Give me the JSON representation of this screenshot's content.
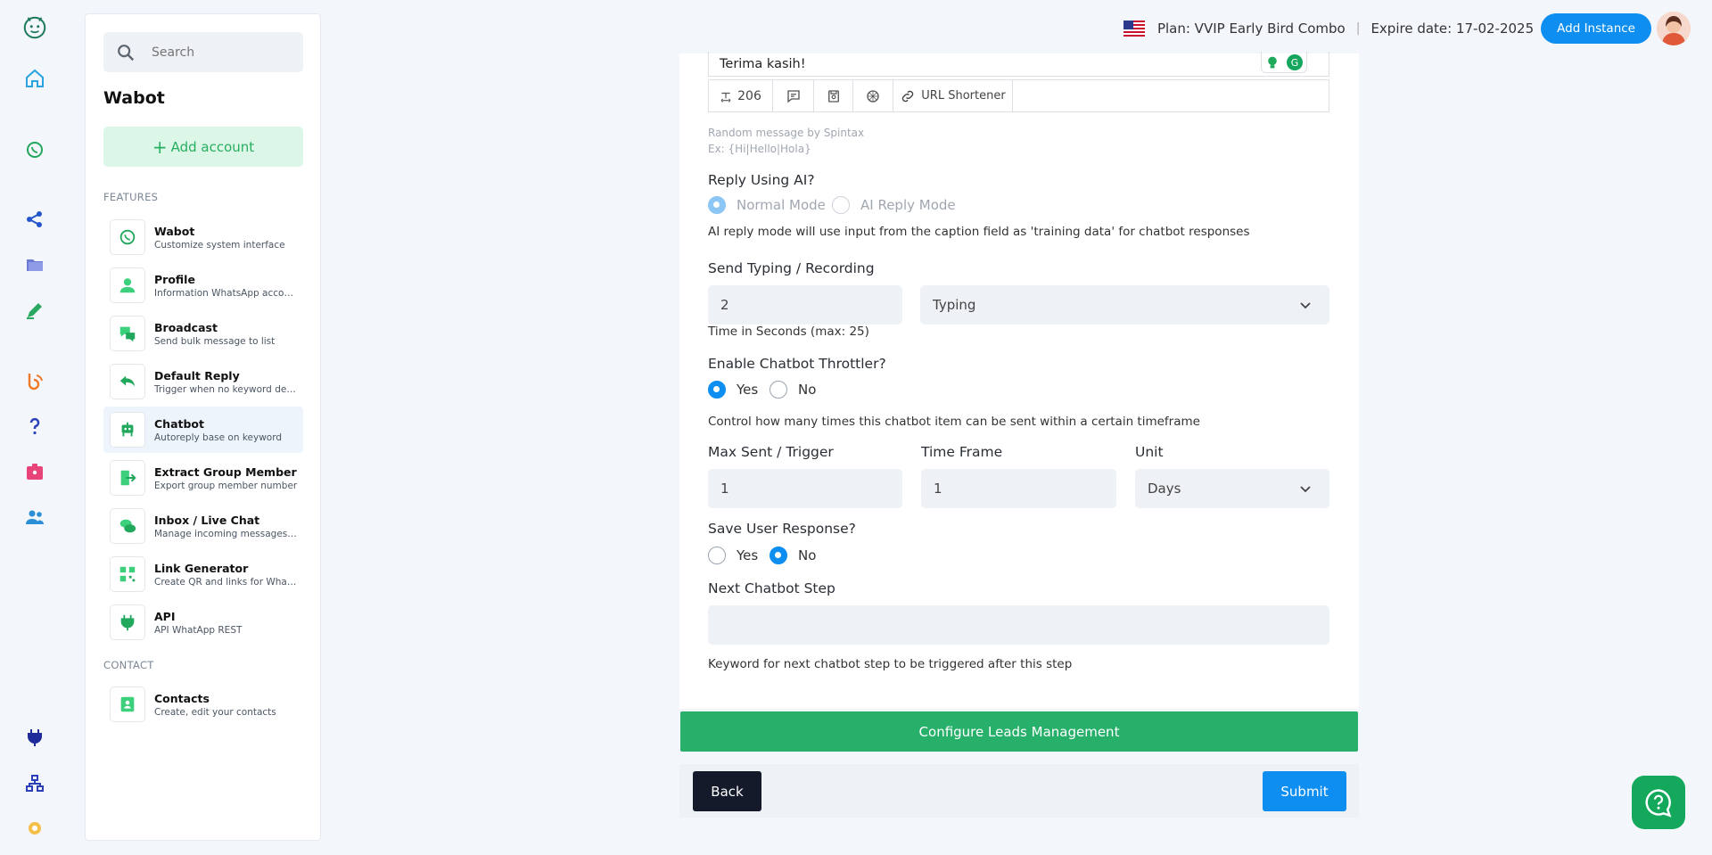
{
  "header": {
    "plan": "Plan: VVIP Early Bird Combo",
    "separator": "|",
    "expire": "Expire date: 17-02-2025",
    "add_instance": "Add Instance"
  },
  "sidebar": {
    "search_placeholder": "Search",
    "title": "Wabot",
    "add_account": "Add account",
    "features_label": "FEATURES",
    "contact_label": "CONTACT",
    "items": [
      {
        "name": "Wabot",
        "desc": "Customize system interface"
      },
      {
        "name": "Profile",
        "desc": "Information WhatsApp account"
      },
      {
        "name": "Broadcast",
        "desc": "Send bulk message to list"
      },
      {
        "name": "Default Reply",
        "desc": "Trigger when no keyword detected"
      },
      {
        "name": "Chatbot",
        "desc": "Autoreply base on keyword"
      },
      {
        "name": "Extract Group Member",
        "desc": "Export group member number"
      },
      {
        "name": "Inbox / Live Chat",
        "desc": "Manage incoming messages and chats"
      },
      {
        "name": "Link Generator",
        "desc": "Create QR and links for WhatsApp"
      },
      {
        "name": "API",
        "desc": "API WhatApp REST"
      }
    ],
    "contacts": {
      "name": "Contacts",
      "desc": "Create, edit your contacts"
    }
  },
  "form": {
    "message_text": "Terima kasih!",
    "char_count": "206",
    "url_shortener": "URL Shortener",
    "spintax_hint": "Random message by Spintax",
    "spintax_example": "Ex: {Hi|Hello|Hola}",
    "reply_ai_label": "Reply Using AI?",
    "normal_mode": "Normal Mode",
    "ai_mode": "AI Reply Mode",
    "ai_note": "AI reply mode will use input from the caption field as 'training data' for chatbot responses",
    "typing_label": "Send Typing / Recording",
    "typing_seconds": "2",
    "typing_type": "Typing",
    "typing_note": "Time in Seconds (max: 25)",
    "throttler_label": "Enable Chatbot Throttler?",
    "yes": "Yes",
    "no": "No",
    "throttler_note": "Control how many times this chatbot item can be sent within a certain timeframe",
    "max_sent_label": "Max Sent / Trigger",
    "max_sent_value": "1",
    "time_frame_label": "Time Frame",
    "time_frame_value": "1",
    "unit_label": "Unit",
    "unit_value": "Days",
    "save_response_label": "Save User Response?",
    "next_step_label": "Next Chatbot Step",
    "next_step_value": "",
    "next_step_note": "Keyword for next chatbot step to be triggered after this step",
    "configure_leads": "Configure Leads Management",
    "back": "Back",
    "submit": "Submit"
  },
  "colors": {
    "primary": "#0d8ef0",
    "green": "#27b06a",
    "dark": "#141a2a"
  }
}
